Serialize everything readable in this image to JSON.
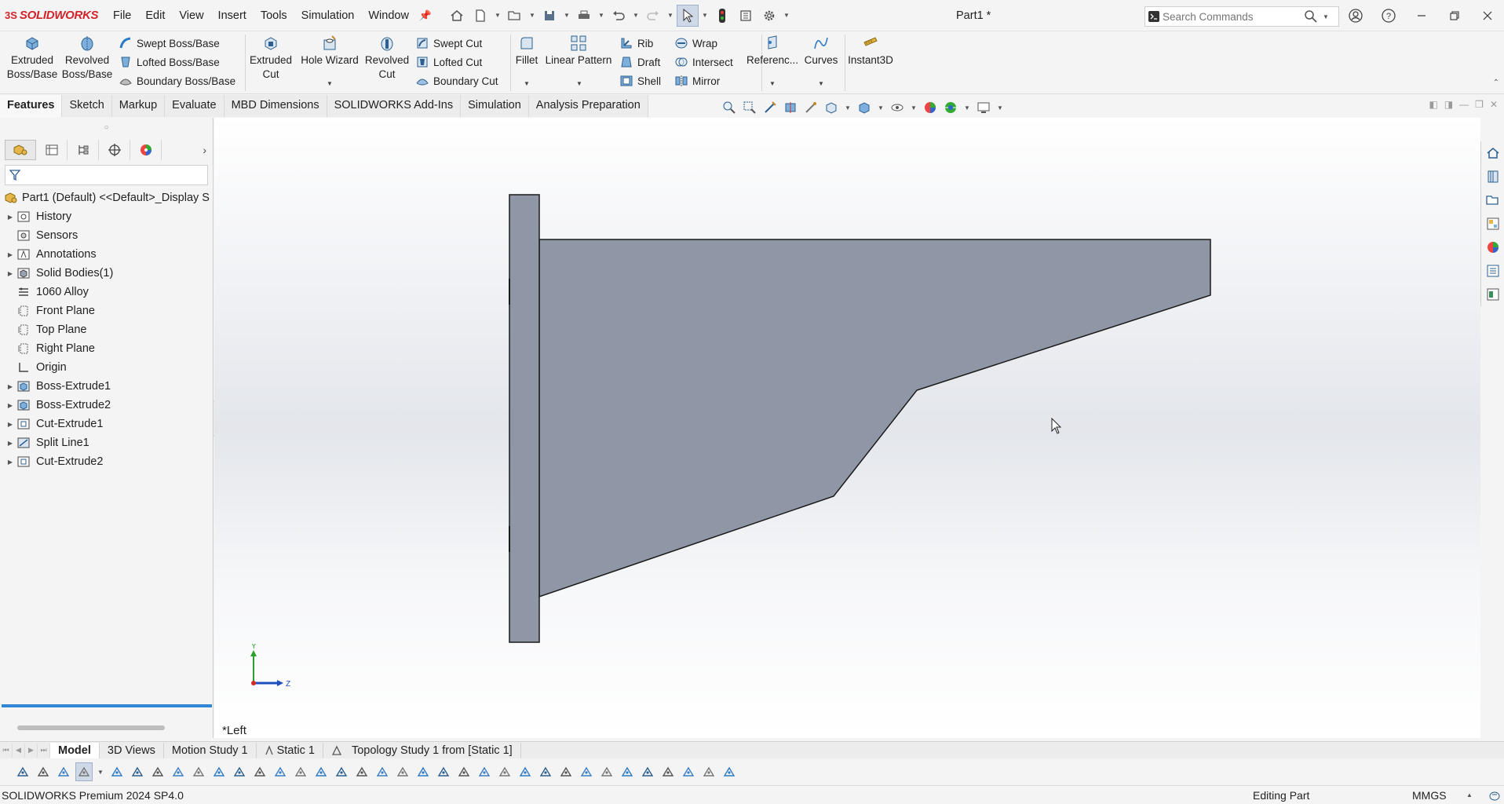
{
  "app": {
    "logo_text": "SOLIDWORKS",
    "document_title": "Part1 *"
  },
  "menu": [
    "File",
    "Edit",
    "View",
    "Insert",
    "Tools",
    "Simulation",
    "Window"
  ],
  "search": {
    "placeholder": "Search Commands"
  },
  "ribbon": {
    "extruded_boss": "Extruded Boss/Base",
    "revolved_boss": "Revolved Boss/Base",
    "swept_boss": "Swept Boss/Base",
    "lofted_boss": "Lofted Boss/Base",
    "boundary_boss": "Boundary Boss/Base",
    "extruded_cut": "Extruded Cut",
    "hole_wizard": "Hole Wizard",
    "revolved_cut": "Revolved Cut",
    "swept_cut": "Swept Cut",
    "lofted_cut": "Lofted Cut",
    "boundary_cut": "Boundary Cut",
    "fillet": "Fillet",
    "linear_pattern": "Linear Pattern",
    "rib": "Rib",
    "draft": "Draft",
    "shell": "Shell",
    "wrap": "Wrap",
    "intersect": "Intersect",
    "mirror": "Mirror",
    "reference": "Referenc...",
    "curves": "Curves",
    "instant3d": "Instant3D"
  },
  "cm_tabs": [
    "Features",
    "Sketch",
    "Markup",
    "Evaluate",
    "MBD Dimensions",
    "SOLIDWORKS Add-Ins",
    "Simulation",
    "Analysis Preparation"
  ],
  "tree": {
    "root": "Part1 (Default) <<Default>_Display S",
    "items": [
      {
        "label": "History",
        "expandable": true,
        "icon": "history-icon"
      },
      {
        "label": "Sensors",
        "expandable": false,
        "icon": "sensors-icon"
      },
      {
        "label": "Annotations",
        "expandable": true,
        "icon": "annotations-icon"
      },
      {
        "label": "Solid Bodies(1)",
        "expandable": true,
        "icon": "solid-bodies-icon"
      },
      {
        "label": "1060 Alloy",
        "expandable": false,
        "icon": "material-icon"
      },
      {
        "label": "Front Plane",
        "expandable": false,
        "icon": "plane-icon"
      },
      {
        "label": "Top Plane",
        "expandable": false,
        "icon": "plane-icon"
      },
      {
        "label": "Right Plane",
        "expandable": false,
        "icon": "plane-icon"
      },
      {
        "label": "Origin",
        "expandable": false,
        "icon": "origin-icon"
      },
      {
        "label": "Boss-Extrude1",
        "expandable": true,
        "icon": "boss-extrude-icon"
      },
      {
        "label": "Boss-Extrude2",
        "expandable": true,
        "icon": "boss-extrude-icon"
      },
      {
        "label": "Cut-Extrude1",
        "expandable": true,
        "icon": "cut-extrude-icon"
      },
      {
        "label": "Split Line1",
        "expandable": true,
        "icon": "split-line-icon"
      },
      {
        "label": "Cut-Extrude2",
        "expandable": true,
        "icon": "cut-extrude-icon"
      }
    ]
  },
  "viewport": {
    "view_label": "*Left",
    "axis_y": "Y",
    "axis_z": "Z",
    "part_fill": "#8f97a6"
  },
  "bottom_tabs": [
    "Model",
    "3D Views",
    "Motion Study 1",
    "Static 1",
    "Topology Study 1 from [Static 1]"
  ],
  "status": {
    "product": "SOLIDWORKS Premium 2024 SP4.0",
    "mode": "Editing Part",
    "units": "MMGS"
  }
}
